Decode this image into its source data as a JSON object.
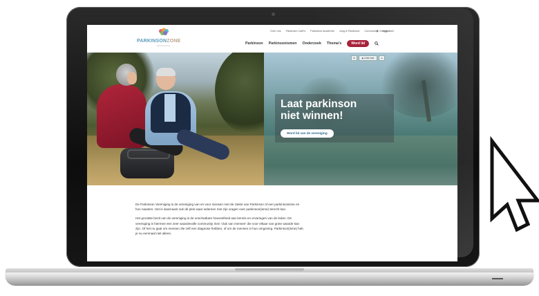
{
  "site": {
    "logo": {
      "name_a": "PARKINSON",
      "name_b": "ZONE",
      "subtitle": "parkinsonzone",
      "icon": "brain-logo-icon"
    },
    "top_nav": [
      "Over ons",
      "Parkinson Café's",
      "Parkinson Academie",
      "Jong & Parkinson",
      "Community",
      "Help mee"
    ],
    "login_label": "Inloggen",
    "main_nav": [
      "Parkinson",
      "Parkinsonismen",
      "Onderzoek",
      "Thema's"
    ],
    "cta_nav_label": "Word lid",
    "search_icon": "search-icon"
  },
  "hero": {
    "title_line1": "Laat parkinson",
    "title_line2": "niet winnen!",
    "button_label": "Word lid van de vereniging",
    "read_aloud_label": "Lees voor"
  },
  "content": {
    "paragraph1": "De Parkinson Vereniging is de vereniging van en voor mensen met de ziekte van Parkinson of een parkinsonisme en hun naasten. Het is daarnaast ook dé plek waar iedereen met zijn vragen over parkinson(isme) terecht kan.",
    "paragraph2": "Het grootste bezit van de vereniging is de onschatbare hoeveelheid aan kennis en ervaringen van de leden. De vereniging is hiermee een zeer waardevolle community. Een 'club van mensen' die voor elkaar van grote waarde kan zijn. Of het nu gaat om mensen die zelf een diagnose hebben, of om de mensen in hun omgeving. Parkinson(isme) heb je nu eenmaal niet alleen."
  },
  "colors": {
    "brand_red": "#a7213a",
    "link_blue": "#2b6b8a",
    "logo_blue": "#5a9bbd"
  }
}
